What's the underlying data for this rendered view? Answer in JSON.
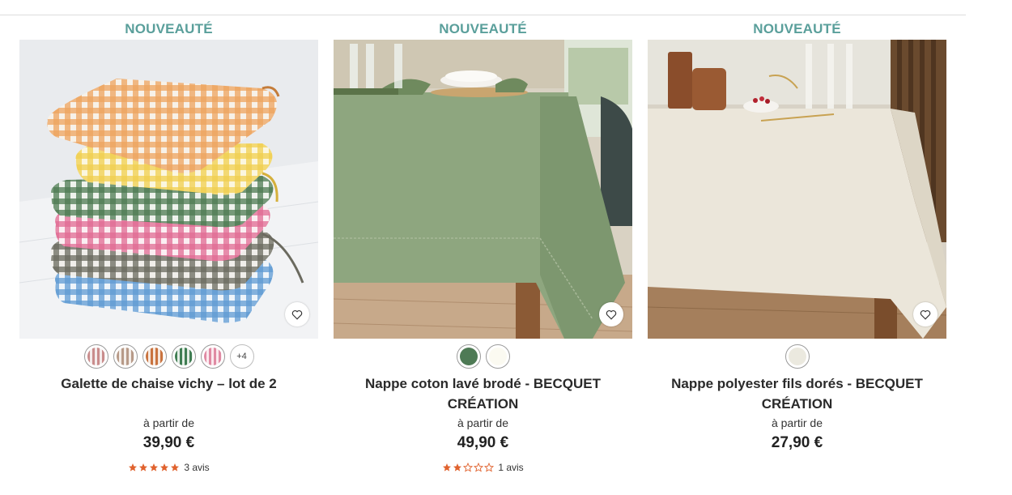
{
  "products": [
    {
      "badge": "NOUVEAUTÉ",
      "image_alt": "Galette de chaise vichy stack",
      "swatches": [
        {
          "color": "#c98c8c",
          "name": "rose-brun"
        },
        {
          "color": "#b79a88",
          "name": "taupe"
        },
        {
          "color": "#c9733f",
          "name": "orange"
        },
        {
          "color": "#3f7d52",
          "name": "vert"
        },
        {
          "color": "#e08aa3",
          "name": "rose"
        }
      ],
      "more_swatches": "+4",
      "title": "Galette de chaise vichy – lot de 2",
      "price_prefix": "à partir de",
      "price": "39,90 €",
      "rating": 5,
      "reviews": "3 avis"
    },
    {
      "badge": "NOUVEAUTÉ",
      "image_alt": "Nappe coton lavé brodé vert",
      "swatches": [
        {
          "color": "#4e7a55",
          "name": "vert"
        },
        {
          "color": "#fbfaf1",
          "name": "blanc"
        }
      ],
      "title": "Nappe coton lavé brodé - BECQUET CRÉATION",
      "price_prefix": "à partir de",
      "price": "49,90 €",
      "rating": 2,
      "reviews": "1 avis"
    },
    {
      "badge": "NOUVEAUTÉ",
      "image_alt": "Nappe polyester fils dorés lin",
      "swatches": [
        {
          "color": "#ebe9df",
          "name": "lin"
        }
      ],
      "title": "Nappe polyester fils dorés - BECQUET CRÉATION",
      "price_prefix": "à partir de",
      "price": "27,90 €"
    }
  ],
  "colors": {
    "badge": "#5a9f9b",
    "star": "#e0622e"
  }
}
